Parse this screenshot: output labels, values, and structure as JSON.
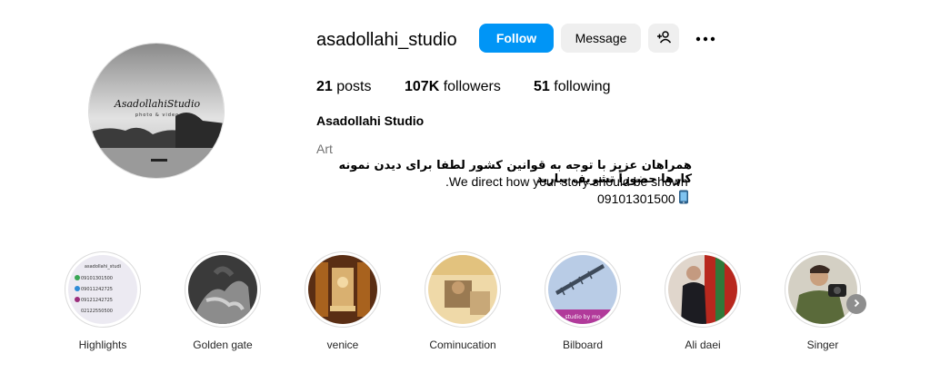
{
  "profile": {
    "username": "asadollahi_studio",
    "follow_label": "Follow",
    "message_label": "Message",
    "add_user_icon": "person-plus-icon",
    "more_icon": "more-options-icon",
    "avatar_logo_text": "AsadollahiStudio",
    "avatar_logo_sub": "photo & video"
  },
  "stats": {
    "posts_count": "21",
    "posts_label": "posts",
    "followers_count": "107K",
    "followers_label": "followers",
    "following_count": "51",
    "following_label": "following"
  },
  "bio": {
    "full_name": "Asadollahi Studio",
    "category": "Art",
    "line_fa": "همراهان عزیز با توجه به قوانین کشور لطفا برای دیدن نمونه کارها حضوراً تشریف بیارید",
    "line_en": ".We direct how your story should be shown",
    "phone_icon": "mobile-phone-icon",
    "phone": "09101301500"
  },
  "highlights": [
    {
      "label": "Highlights",
      "thumb_lines": [
        "asadollahi_studi",
        "09101301500",
        "09011242725",
        "09121242725",
        "02122550500"
      ]
    },
    {
      "label": "Golden gate"
    },
    {
      "label": "venice"
    },
    {
      "label": "Cominucation"
    },
    {
      "label": "Bilboard",
      "thumb_text": "studio by mo"
    },
    {
      "label": "Ali daei"
    },
    {
      "label": "Singer"
    }
  ],
  "colors": {
    "primary_blue": "#0095f6",
    "secondary_button": "#efefef",
    "muted_text": "#737373"
  }
}
